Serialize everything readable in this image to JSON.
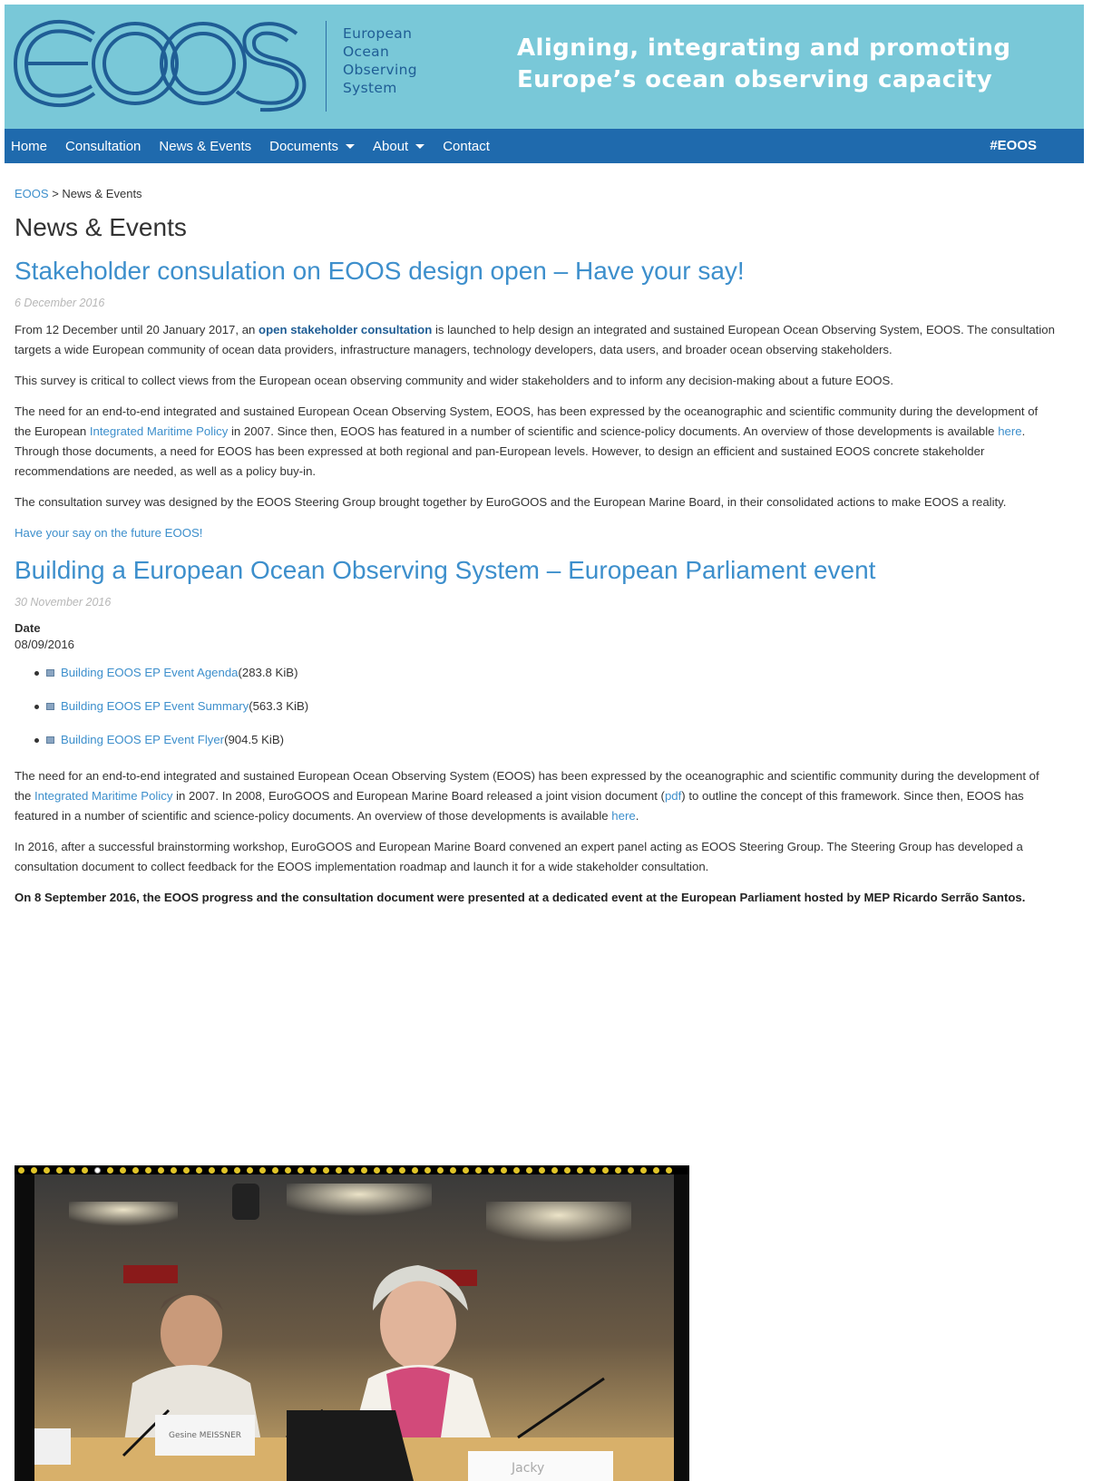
{
  "header": {
    "logo_letters": "EOOS",
    "logo_words": [
      "European",
      "Ocean",
      "Observing",
      "System"
    ],
    "tagline_lines": [
      "Aligning, integrating and promoting",
      "Europe’s ocean observing capacity"
    ]
  },
  "nav": {
    "items": [
      {
        "label": "Home"
      },
      {
        "label": "Consultation"
      },
      {
        "label": "News & Events"
      },
      {
        "label": "Documents"
      },
      {
        "label": "About"
      },
      {
        "label": "Contact"
      }
    ],
    "hashtag": "#EOOS"
  },
  "breadcrumb": {
    "home": "EOOS",
    "separator": " > ",
    "current": "News & Events"
  },
  "page_title": "News & Events",
  "post1": {
    "title": "Stakeholder consulation on EOOS design open – Have your say!",
    "date": "6 December 2016",
    "p1_before": "From 12 December until 20 January 2017, an ",
    "p1_link": "open stakeholder consultation",
    "p1_after": " is launched to help design an integrated and sustained European Ocean Observing System, EOOS. The consultation targets a wide European community of ocean data providers, infrastructure managers, technology developers, data users, and broader ocean observing stakeholders.",
    "p2": "This survey is critical to collect views from the European ocean observing community and wider stakeholders and to inform any decision-making about a future EOOS.",
    "p3_a": "The need for an end-to-end integrated and sustained European Ocean Observing System, EOOS, has been expressed by the oceanographic and scientific community during the development of the European ",
    "p3_link1": "Integrated Maritime Policy",
    "p3_b": " in 2007. Since then, EOOS has featured in a number of scientific and science-policy documents. An overview of those developments is available ",
    "p3_link2": "here",
    "p3_c": ". Through those documents, a need for EOOS has been expressed at both regional and pan-European levels. However, to design an efficient and sustained EOOS concrete stakeholder recommendations are needed, as well as a policy buy-in.",
    "p4": "The consultation survey was designed by the EOOS Steering Group brought together by EuroGOOS and the European Marine Board, in their consolidated actions to make EOOS a reality.",
    "cta": "Have your say on the future EOOS!"
  },
  "post2": {
    "title": "Building a European Ocean Observing System – European Parliament event",
    "date": "30 November 2016",
    "date_label": "Date",
    "date_value": "08/09/2016",
    "downloads": [
      {
        "name": "Building EOOS EP Event Agenda",
        "size": " (283.8 KiB)"
      },
      {
        "name": "Building EOOS EP Event Summary",
        "size": " (563.3 KiB)"
      },
      {
        "name": "Building EOOS EP Event Flyer",
        "size": " (904.5 KiB)"
      }
    ],
    "p1_a": "The need for an end-to-end integrated and sustained European Ocean Observing System (EOOS) has been expressed by the oceanographic and scientific community during the development of the ",
    "p1_link1": "Integrated Maritime Policy",
    "p1_b": " in 2007. In 2008, EuroGOOS and European Marine Board released a joint vision document (",
    "p1_link2": "pdf",
    "p1_c": ") to outline the concept of this framework. Since then, EOOS has featured in a number of scientific and science-policy documents. An overview of those developments is available ",
    "p1_link3": "here",
    "p1_d": ".",
    "p2": "In 2016, after a successful brainstorming workshop, EuroGOOS and European Marine Board convened an expert panel acting as EOOS Steering Group. The Steering Group has developed a consultation document to collect feedback for the EOOS implementation roadmap and launch it for a wide stakeholder consultation.",
    "p3": "On 8 September 2016, the EOOS progress and the consultation document were presented at a dedicated event at the European Parliament hosted by MEP Ricardo Serrão Santos.",
    "photo_nameplate": "Gesine MEISSNER",
    "photo_nameplate2": "Jacky",
    "slideshow_dot_count": 52,
    "slideshow_active_index": 6
  }
}
